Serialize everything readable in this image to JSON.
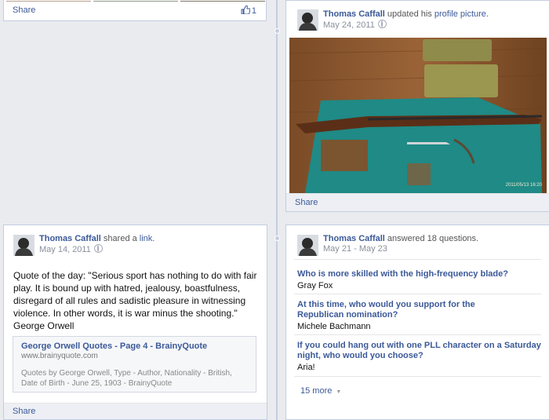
{
  "top_card": {
    "share_label": "Share",
    "like_count": "1"
  },
  "profile_post": {
    "author": "Thomas Caffall",
    "action": "updated his",
    "target_link": "profile picture.",
    "date": "May 24, 2011",
    "photo_timestamp": "2011/05/13 16:20",
    "share_label": "Share"
  },
  "link_post": {
    "author": "Thomas Caffall",
    "action": "shared a",
    "target_link": "link.",
    "date": "May 14, 2011",
    "quote": "Quote of the day: \"Serious sport has nothing to do with fair play. It is bound up with hatred, jealousy, boastfulness, disregard of all rules and sadistic pleasure in witnessing violence. In other words, it is war minus the shooting.\" George Orwell",
    "preview": {
      "title": "George Orwell Quotes - Page 4 - BrainyQuote",
      "domain": "www.brainyquote.com",
      "description": "Quotes by George Orwell, Type - Author, Nationality - British, Date of Birth - June 25, 1903 - BrainyQuote"
    },
    "share_label": "Share"
  },
  "questions_post": {
    "author": "Thomas Caffall",
    "action": "answered 18 questions.",
    "date": "May 21 - May 23",
    "items": [
      {
        "question": "Who is more skilled with the high-frequency blade?",
        "answer": "Gray Fox"
      },
      {
        "question": "At this time, who would you support for the Republican nomination?",
        "answer": "Michele Bachmann"
      },
      {
        "question": "If you could hang out with one PLL character on a Saturday night, who would you choose?",
        "answer": "Aria!"
      }
    ],
    "more_label": "15 more"
  },
  "colors": {
    "link": "#3b5998",
    "timeline": "#c4cde0",
    "background": "#e9ebee"
  }
}
